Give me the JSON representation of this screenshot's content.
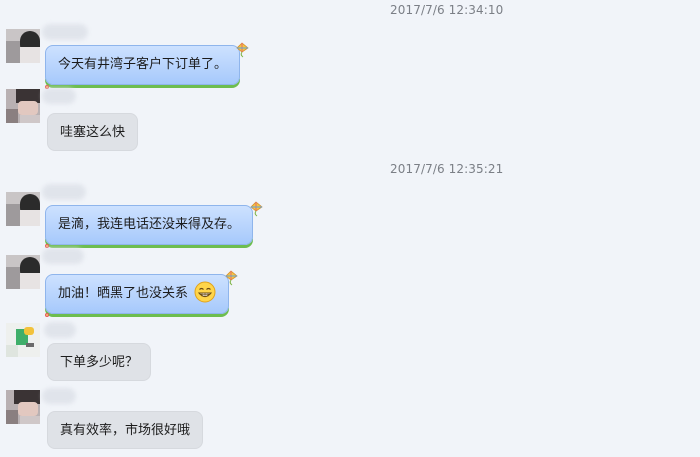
{
  "timestamps": [
    "2017/7/6 12:34:10",
    "2017/7/6 12:35:21"
  ],
  "messages": [
    {
      "text": "今天有井湾子客户下订单了。",
      "style": "blue"
    },
    {
      "text": "哇塞这么快",
      "style": "grey"
    },
    {
      "text": "是滴，我连电话还没来得及存。",
      "style": "blue"
    },
    {
      "text": "加油！晒黑了也没关系",
      "style": "blue",
      "emoji": "grin-emoji"
    },
    {
      "text": "下单多少呢？",
      "style": "grey"
    },
    {
      "text": "真有效率，市场很好哦",
      "style": "grey"
    }
  ],
  "colors": {
    "background": "#f1f4f9",
    "bubble_blue": "#b4d2fd",
    "bubble_blue_border": "#8fb5ec",
    "bubble_green_underline": "#6dbd4f",
    "bubble_grey": "#dfe2e7"
  }
}
